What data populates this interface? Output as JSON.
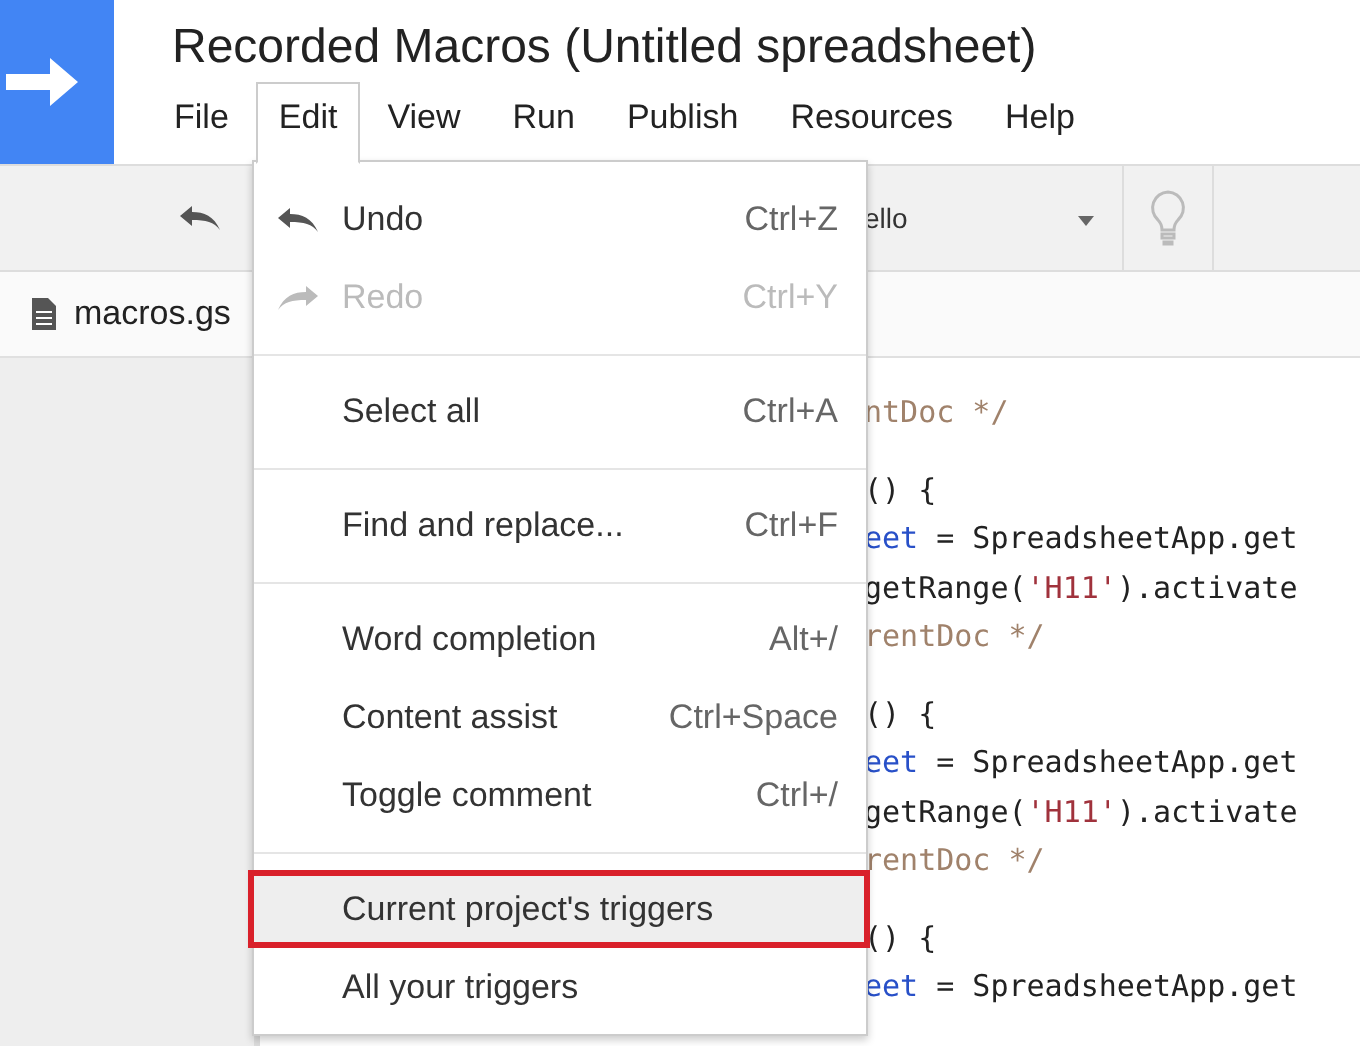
{
  "app": {
    "title": "Recorded Macros (Untitled spreadsheet)"
  },
  "menubar": [
    {
      "label": "File",
      "selected": false
    },
    {
      "label": "Edit",
      "selected": true
    },
    {
      "label": "View",
      "selected": false
    },
    {
      "label": "Run",
      "selected": false
    },
    {
      "label": "Publish",
      "selected": false
    },
    {
      "label": "Resources",
      "selected": false
    },
    {
      "label": "Help",
      "selected": false
    }
  ],
  "toolbar": {
    "function_select": "ello"
  },
  "file_tabs": [
    {
      "label": "macros.gs"
    }
  ],
  "code_lines": [
    {
      "kind": "code",
      "tokens": [
        {
          "text": "ntDoc */",
          "kind": "comment"
        }
      ]
    },
    {
      "kind": "blank"
    },
    {
      "kind": "code",
      "tokens": [
        {
          "text": "() {",
          "kind": "plain"
        }
      ]
    },
    {
      "kind": "code",
      "tokens": [
        {
          "text": "eet",
          "kind": "variable"
        },
        {
          "text": " = SpreadsheetApp.get",
          "kind": "plain"
        }
      ]
    },
    {
      "kind": "code",
      "tokens": [
        {
          "text": "getRange(",
          "kind": "plain"
        },
        {
          "text": "'H11'",
          "kind": "string"
        },
        {
          "text": ").activate",
          "kind": "plain"
        }
      ]
    },
    {
      "kind": "code",
      "tokens": [
        {
          "text": "rentDoc */",
          "kind": "comment"
        }
      ]
    },
    {
      "kind": "blank"
    },
    {
      "kind": "code",
      "tokens": [
        {
          "text": "() {",
          "kind": "plain"
        }
      ]
    },
    {
      "kind": "code",
      "tokens": [
        {
          "text": "eet",
          "kind": "variable"
        },
        {
          "text": " = SpreadsheetApp.get",
          "kind": "plain"
        }
      ]
    },
    {
      "kind": "code",
      "tokens": [
        {
          "text": "getRange(",
          "kind": "plain"
        },
        {
          "text": "'H11'",
          "kind": "string"
        },
        {
          "text": ").activate",
          "kind": "plain"
        }
      ]
    },
    {
      "kind": "code",
      "tokens": [
        {
          "text": "rentDoc */",
          "kind": "comment"
        }
      ]
    },
    {
      "kind": "blank"
    },
    {
      "kind": "code",
      "tokens": [
        {
          "text": "() {",
          "kind": "plain"
        }
      ]
    },
    {
      "kind": "code",
      "tokens": [
        {
          "text": "eet",
          "kind": "variable"
        },
        {
          "text": " = SpreadsheetApp.get",
          "kind": "plain"
        }
      ]
    }
  ],
  "edit_menu": [
    {
      "kind": "undo",
      "label": "Undo",
      "shortcut": "Ctrl+Z",
      "disabled": false,
      "selected": false
    },
    {
      "kind": "redo",
      "label": "Redo",
      "shortcut": "Ctrl+Y",
      "disabled": true,
      "selected": false
    },
    {
      "kind": "separator"
    },
    {
      "kind": "item",
      "label": "Select all",
      "shortcut": "Ctrl+A",
      "disabled": false,
      "selected": false
    },
    {
      "kind": "separator"
    },
    {
      "kind": "item",
      "label": "Find and replace...",
      "shortcut": "Ctrl+F",
      "disabled": false,
      "selected": false
    },
    {
      "kind": "separator"
    },
    {
      "kind": "item",
      "label": "Word completion",
      "shortcut": "Alt+/",
      "disabled": false,
      "selected": false
    },
    {
      "kind": "item",
      "label": "Content assist",
      "shortcut": "Ctrl+Space",
      "disabled": false,
      "selected": false
    },
    {
      "kind": "item",
      "label": "Toggle comment",
      "shortcut": "Ctrl+/",
      "disabled": false,
      "selected": false
    },
    {
      "kind": "separator"
    },
    {
      "kind": "item",
      "label": "Current project's triggers",
      "disabled": false,
      "selected": true
    },
    {
      "kind": "item",
      "label": "All your triggers",
      "disabled": false,
      "selected": false
    }
  ]
}
